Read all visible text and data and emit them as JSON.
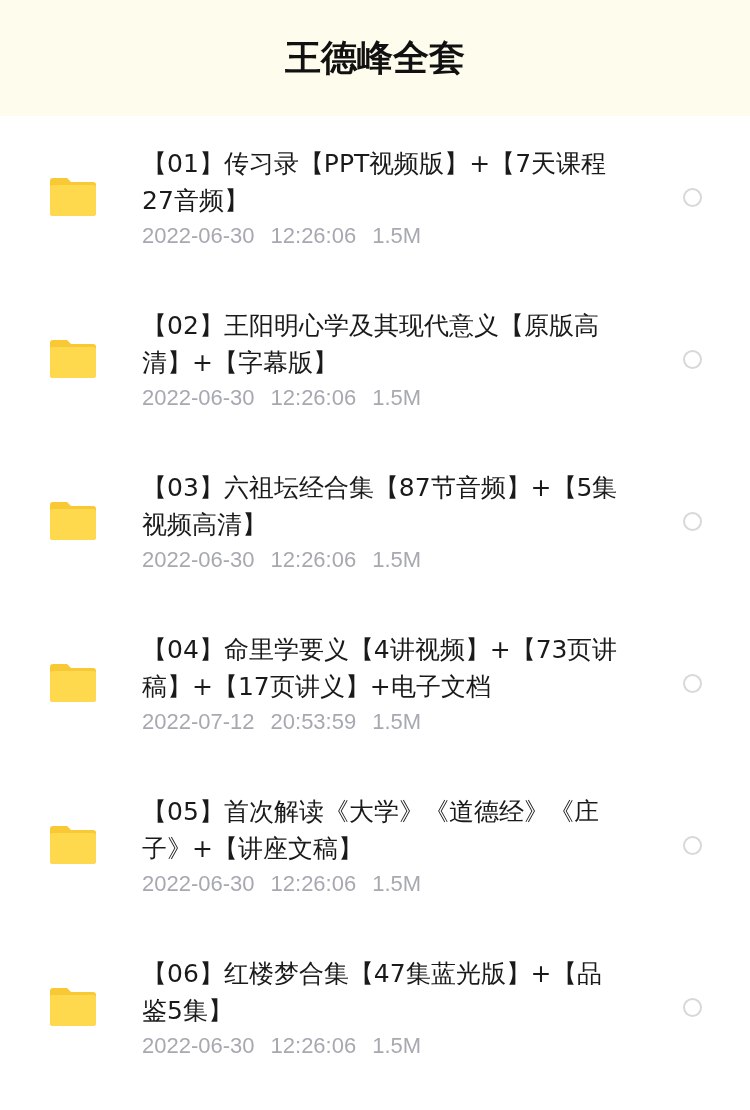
{
  "header": {
    "title": "王德峰全套"
  },
  "files": [
    {
      "name": "【01】传习录【PPT视频版】+【7天课程27音频】",
      "date": "2022-06-30",
      "time": "12:26:06",
      "size": "1.5M",
      "selected": false
    },
    {
      "name": "【02】王阳明心学及其现代意义【原版高清】+【字幕版】",
      "date": "2022-06-30",
      "time": "12:26:06",
      "size": "1.5M",
      "selected": false
    },
    {
      "name": "【03】六祖坛经合集【87节音频】+【5集视频高清】",
      "date": "2022-06-30",
      "time": "12:26:06",
      "size": "1.5M",
      "selected": false
    },
    {
      "name": "【04】命里学要义【4讲视频】+【73页讲稿】+【17页讲义】+电子文档",
      "date": "2022-07-12",
      "time": "20:53:59",
      "size": "1.5M",
      "selected": false
    },
    {
      "name": "【05】首次解读《大学》《道德经》《庄子》+【讲座文稿】",
      "date": "2022-06-30",
      "time": "12:26:06",
      "size": "1.5M",
      "selected": false
    },
    {
      "name": "【06】红楼梦合集【47集蓝光版】+【品鉴5集】",
      "date": "2022-06-30",
      "time": "12:26:06",
      "size": "1.5M",
      "selected": false
    }
  ]
}
